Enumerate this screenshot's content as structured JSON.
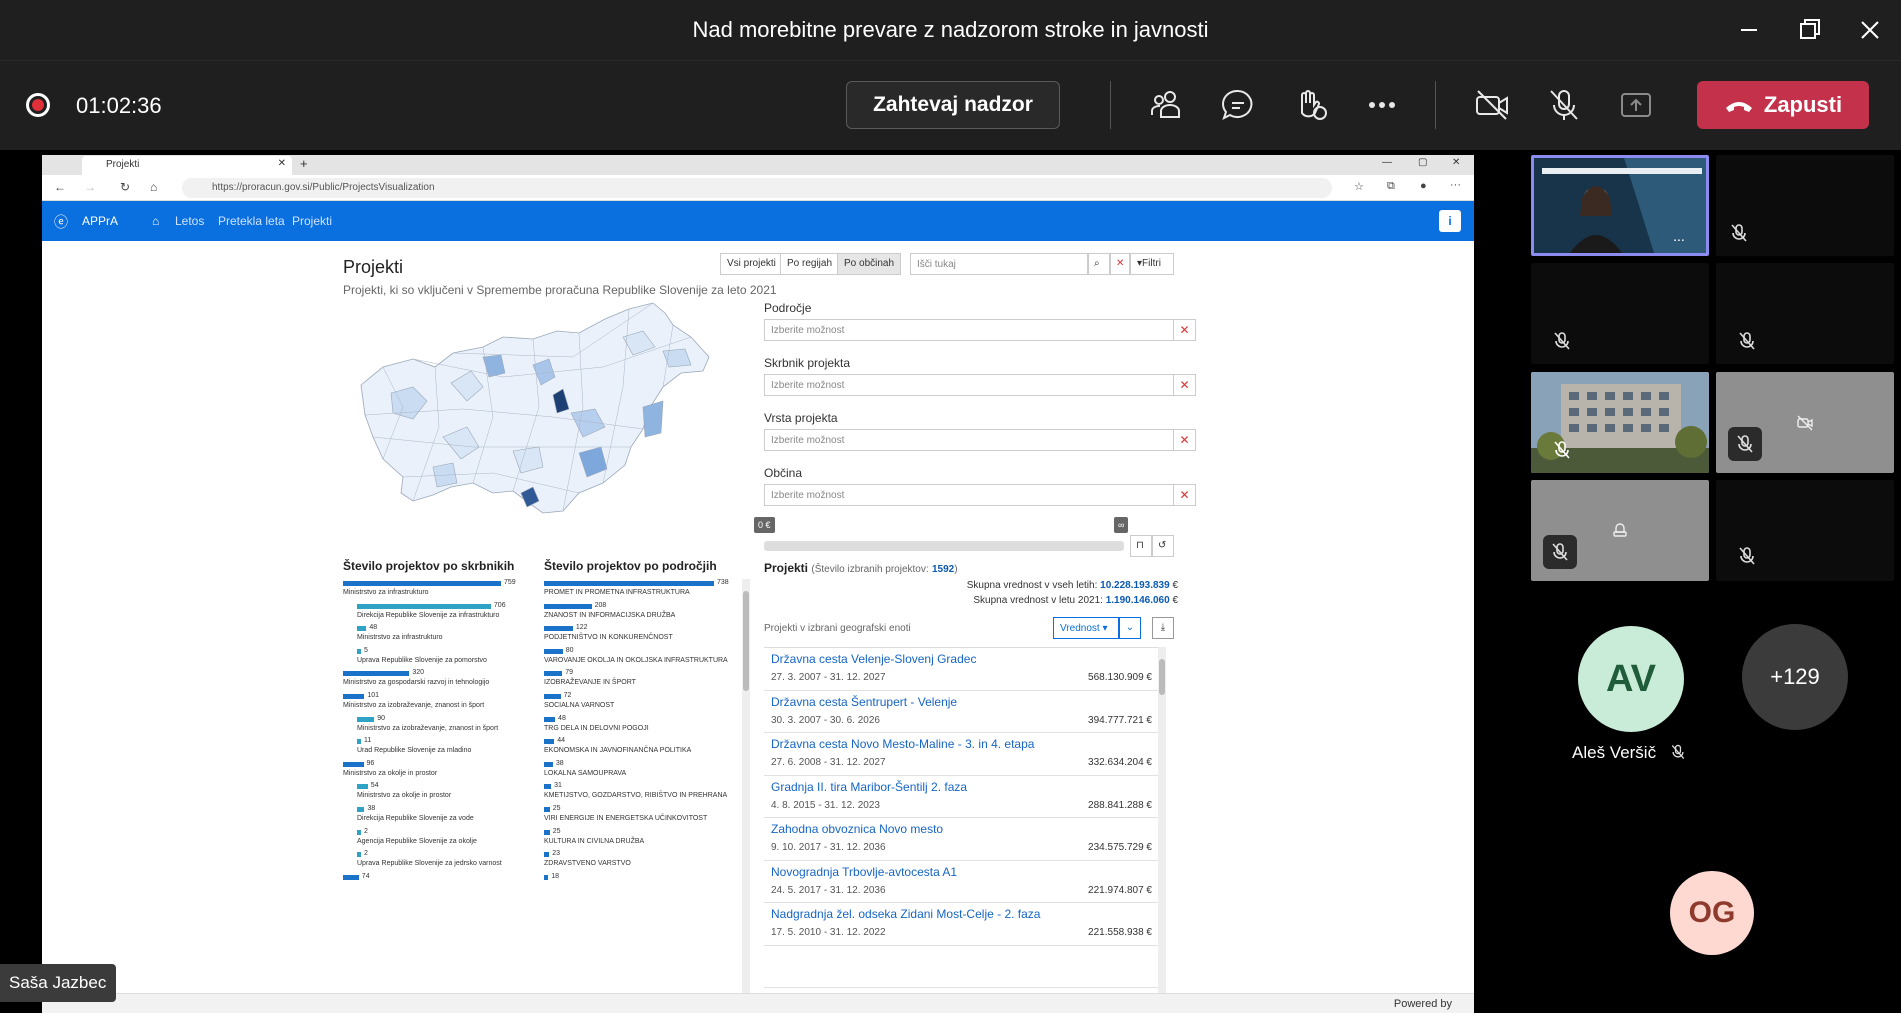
{
  "window": {
    "title": "Nad morebitne prevare z nadzorom stroke in javnosti"
  },
  "toolbar": {
    "timer": "01:02:36",
    "request_control": "Zahtevaj nadzor",
    "leave": "Zapusti",
    "icons": [
      "people-icon",
      "chat-icon",
      "raise-hand-icon",
      "more-icon",
      "camera-off-icon",
      "mic-off-icon",
      "share-icon"
    ]
  },
  "browser": {
    "tab_title": "Projekti",
    "url": "https://proracun.gov.si/Public/ProjectsVisualization"
  },
  "app": {
    "brand": "APPrA",
    "nav": [
      "Letos",
      "Pretekla leta",
      "Projekti"
    ],
    "page_title": "Projekti",
    "subtitle": "Projekti, ki so vključeni v Spremembe proračuna Republike Slovenije za leto 2021",
    "view_buttons": [
      "Vsi projekti",
      "Po regijah",
      "Po občinah"
    ],
    "search_placeholder": "Išči tukaj",
    "filters_label": "Filtri",
    "filters": [
      {
        "label": "Področje",
        "placeholder": "Izberite možnost"
      },
      {
        "label": "Skrbnik projekta",
        "placeholder": "Izberite možnost"
      },
      {
        "label": "Vrsta projekta",
        "placeholder": "Izberite možnost"
      },
      {
        "label": "Občina",
        "placeholder": "Izberite možnost"
      }
    ],
    "slider": {
      "min_label": "0 €",
      "max_label": "∞"
    },
    "skrbniki_title": "Število projektov po skrbnikih",
    "podrocja_title": "Število projektov po področjih",
    "skrbniki": [
      {
        "label": "Ministrstvo za infrastrukturo",
        "value": "759",
        "indent": 0,
        "ratio": 1.0
      },
      {
        "label": "Direkcija Republike Slovenije za infrastrukturo",
        "value": "706",
        "indent": 1,
        "ratio": 0.93
      },
      {
        "label": "Ministrstvo za infrastrukturo",
        "value": "48",
        "indent": 1,
        "ratio": 0.065
      },
      {
        "label": "Uprava Republike Slovenije za pomorstvo",
        "value": "5",
        "indent": 1,
        "ratio": 0.012
      },
      {
        "label": "Ministrstvo za gospodarski razvoj in tehnologijo",
        "value": "320",
        "indent": 0,
        "ratio": 0.42
      },
      {
        "label": "Ministrstvo za izobraževanje, znanost in šport",
        "value": "101",
        "indent": 0,
        "ratio": 0.135
      },
      {
        "label": "Ministrstvo za izobraževanje, znanost in šport",
        "value": "90",
        "indent": 1,
        "ratio": 0.12
      },
      {
        "label": "Urad Republike Slovenije za mladino",
        "value": "11",
        "indent": 1,
        "ratio": 0.02
      },
      {
        "label": "Ministrstvo za okolje in prostor",
        "value": "96",
        "indent": 0,
        "ratio": 0.13
      },
      {
        "label": "Ministrstvo za okolje in prostor",
        "value": "54",
        "indent": 1,
        "ratio": 0.075
      },
      {
        "label": "Direkcija Republike Slovenije za vode",
        "value": "38",
        "indent": 1,
        "ratio": 0.052
      },
      {
        "label": "Agencija Republike Slovenije za okolje",
        "value": "2",
        "indent": 1,
        "ratio": 0.01
      },
      {
        "label": "Uprava Republike Slovenije za jedrsko varnost",
        "value": "2",
        "indent": 1,
        "ratio": 0.01
      },
      {
        "label": "",
        "value": "74",
        "indent": 0,
        "ratio": 0.1
      }
    ],
    "podrocja": [
      {
        "label": "PROMET IN PROMETNA INFRASTRUKTURA",
        "value": "738",
        "ratio": 1.0
      },
      {
        "label": "ZNANOST IN INFORMACIJSKA DRUŽBA",
        "value": "208",
        "ratio": 0.28
      },
      {
        "label": "PODJETNIŠTVO IN KONKURENČNOST",
        "value": "122",
        "ratio": 0.17
      },
      {
        "label": "VAROVANJE OKOLJA IN OKOLJSKA INFRASTRUKTURA",
        "value": "80",
        "ratio": 0.11
      },
      {
        "label": "IZOBRAŽEVANJE IN ŠPORT",
        "value": "79",
        "ratio": 0.107
      },
      {
        "label": "SOCIALNA VARNOST",
        "value": "72",
        "ratio": 0.098
      },
      {
        "label": "TRG DELA IN DELOVNI POGOJI",
        "value": "48",
        "ratio": 0.065
      },
      {
        "label": "EKONOMSKA IN JAVNOFINANČNA POLITIKA",
        "value": "44",
        "ratio": 0.06
      },
      {
        "label": "LOKALNA SAMOUPRAVA",
        "value": "38",
        "ratio": 0.052
      },
      {
        "label": "KMETIJSTVO, GOZDARSTVO, RIBIŠTVO IN PREHRANA",
        "value": "31",
        "ratio": 0.042
      },
      {
        "label": "VIRI ENERGIJE IN ENERGETSKA UČINKOVITOST",
        "value": "25",
        "ratio": 0.034
      },
      {
        "label": "KULTURA IN CIVILNA DRUŽBA",
        "value": "25",
        "ratio": 0.034
      },
      {
        "label": "ZDRAVSTVENO VARSTVO",
        "value": "23",
        "ratio": 0.031
      },
      {
        "label": "",
        "value": "18",
        "ratio": 0.025
      }
    ],
    "projects_title": "Projekti",
    "projects_count_text": "(Število izbranih projektov:",
    "projects_count": "1592",
    "total_all_years_label": "Skupna vrednost v vseh letih:",
    "total_all_years": "10.228.193.839",
    "total_2021_label": "Skupna vrednost v letu 2021:",
    "total_2021": "1.190.146.060",
    "currency": "€",
    "geo_label": "Projekti v izbrani geografski enoti",
    "sort_label": "Vrednost",
    "projects": [
      {
        "name": "Državna cesta Velenje-Slovenj Gradec",
        "dates": "27. 3. 2007 - 31. 12. 2027",
        "value": "568.130.909 €"
      },
      {
        "name": "Državna cesta Šentrupert - Velenje",
        "dates": "30. 3. 2007 - 30. 6. 2026",
        "value": "394.777.721 €"
      },
      {
        "name": "Državna cesta Novo Mesto-Maline - 3. in 4. etapa",
        "dates": "27. 6. 2008 - 31. 12. 2027",
        "value": "332.634.204 €"
      },
      {
        "name": "Gradnja II. tira Maribor-Šentilj 2. faza",
        "dates": "4. 8. 2015 - 31. 12. 2023",
        "value": "288.841.288 €"
      },
      {
        "name": "Zahodna obvoznica Novo mesto",
        "dates": "9. 10. 2017 - 31. 12. 2036",
        "value": "234.575.729 €"
      },
      {
        "name": "Novogradnja Trbovlje-avtocesta A1",
        "dates": "24. 5. 2017 - 31. 12. 2036",
        "value": "221.974.807 €"
      },
      {
        "name": "Nadgradnja žel. odseka Zidani Most-Celje - 2. faza",
        "dates": "17. 5. 2010 - 31. 12. 2022",
        "value": "221.558.938 €"
      },
      {
        "name": "",
        "dates": "",
        "value": ""
      }
    ],
    "status": "Powered by"
  },
  "participants": {
    "av_initials": "AV",
    "av_name": "Aleš Veršič",
    "more_count": "+129",
    "og_initials": "OG",
    "presenter": "Saša Jazbec"
  },
  "colors": {
    "teams_bg": "#1f1f1f",
    "leave_red": "#c4314b",
    "app_blue": "#0a6fdf",
    "bar_blue": "#1a73c9",
    "bar_teal": "#2ea3c6",
    "link_blue": "#1666c5",
    "av_bg": "#c9ecd8",
    "av_fg": "#1e5c3a",
    "og_bg": "#fdd9d2",
    "og_fg": "#8e3a2d",
    "more_bg": "#3b3b3b"
  }
}
